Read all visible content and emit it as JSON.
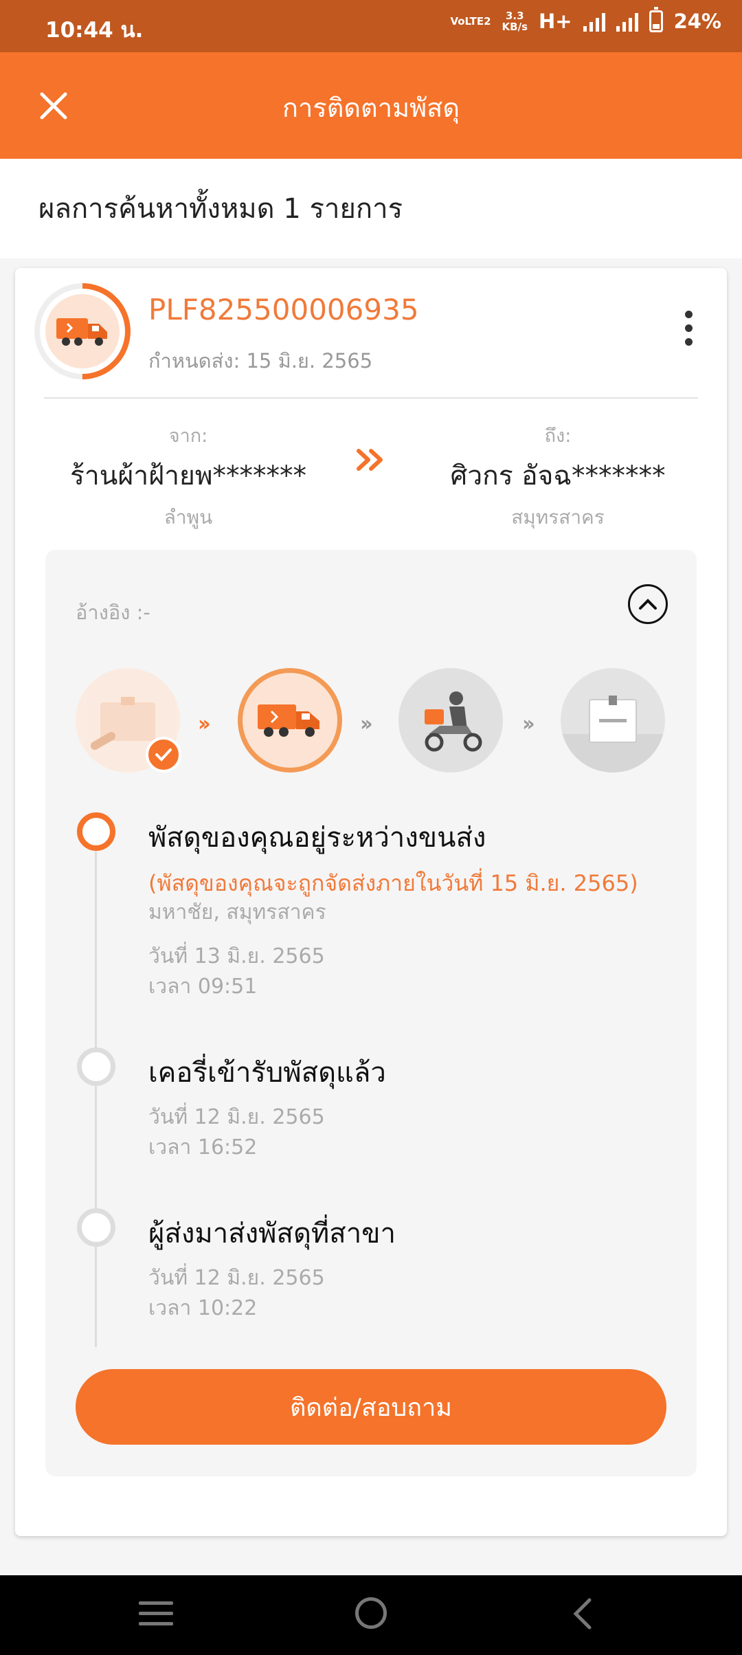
{
  "status_bar": {
    "time": "10:44 น.",
    "network_top": "VoLTE2",
    "speed_value": "3.3",
    "speed_unit": "KB/s",
    "network_type": "H+",
    "battery": "24%"
  },
  "header": {
    "title": "การติดตามพัสดุ",
    "close_icon": "close-icon"
  },
  "results": {
    "summary": "ผลการค้นหาทั้งหมด 1 รายการ"
  },
  "parcel": {
    "tracking_number": "PLF825500006935",
    "due_date": "กำหนดส่ง: 15 มิ.ย. 2565",
    "from_label": "จาก:",
    "from_name": "ร้านผ้าฝ้ายพ*******",
    "from_location": "ลำพูน",
    "to_label": "ถึง:",
    "to_name": "ศิวกร อัจฉ*******",
    "to_location": "สมุทรสาคร"
  },
  "details": {
    "reference_label": "อ้างอิง :-",
    "progress_steps": [
      {
        "name": "picked-up",
        "done": true
      },
      {
        "name": "in-transit",
        "current": true
      },
      {
        "name": "out-for-delivery"
      },
      {
        "name": "delivered"
      }
    ],
    "timeline": [
      {
        "title": "พัสดุของคุณอยู่ระหว่างขนส่ง",
        "note": "(พัสดุของคุณจะถูกจัดส่งภายในวันที่ 15 มิ.ย. 2565)",
        "location": "มหาชัย, สมุทรสาคร",
        "date": "วันที่ 13 มิ.ย. 2565",
        "time": "เวลา 09:51"
      },
      {
        "title": "เคอรี่เข้ารับพัสดุแล้ว",
        "date": "วันที่ 12 มิ.ย. 2565",
        "time": "เวลา 16:52"
      },
      {
        "title": "ผู้ส่งมาส่งพัสดุที่สาขา",
        "date": "วันที่ 12 มิ.ย. 2565",
        "time": "เวลา 10:22"
      }
    ],
    "contact_button": "ติดต่อ/สอบถาม"
  },
  "colors": {
    "brand": "#f5732a",
    "status_bar": "#c0581f",
    "accent_text": "#f07a3a"
  }
}
